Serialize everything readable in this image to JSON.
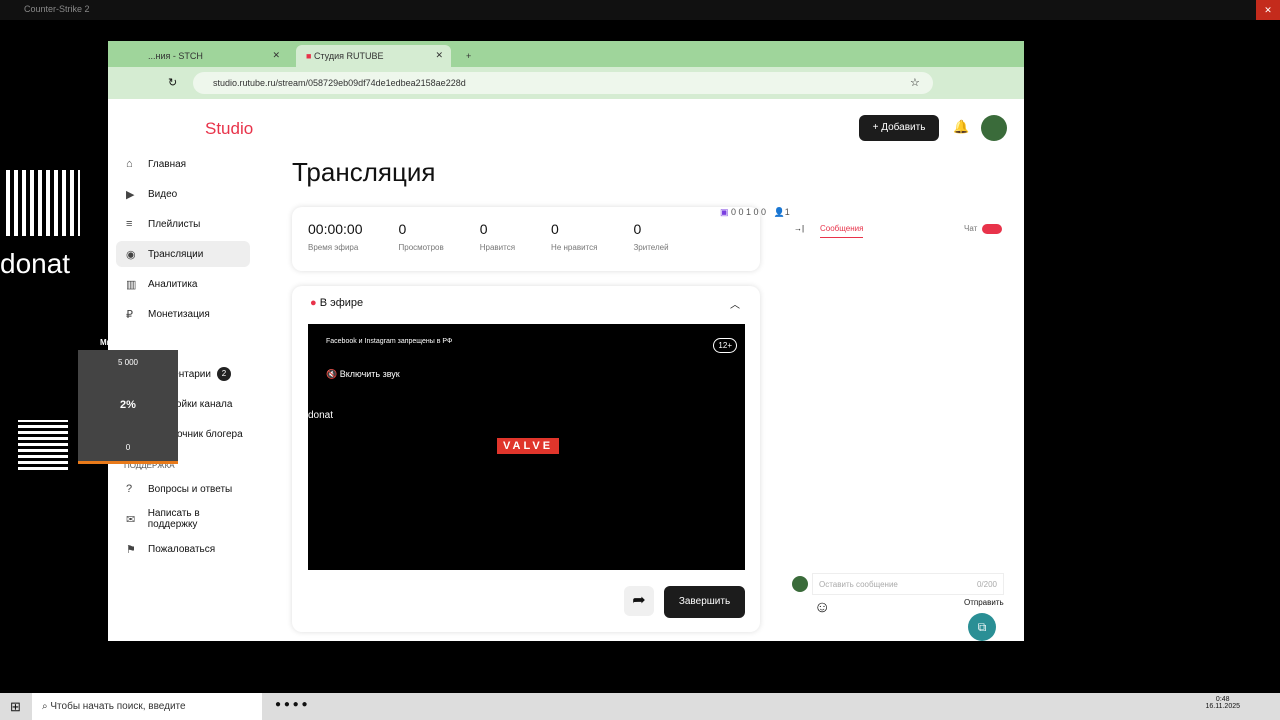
{
  "os": {
    "window_title": "Counter-Strike 2",
    "taskbar_search": "Чтобы начать поиск, введите",
    "time": "0:48",
    "date": "16.11.2025"
  },
  "browser": {
    "tabs": [
      {
        "label": "...ния - STCH"
      },
      {
        "label": "Студия RUTUBE"
      }
    ],
    "url": "studio.rutube.ru/stream/058729eb09df74de1edbea2158ae228d"
  },
  "header": {
    "logo": "Studio",
    "add_label": "Добавить"
  },
  "sidebar": {
    "items": [
      {
        "label": "Главная",
        "icon": "⌂"
      },
      {
        "label": "Видео",
        "icon": "▶"
      },
      {
        "label": "Плейлисты",
        "icon": "≡"
      },
      {
        "label": "Трансляции",
        "icon": "◉"
      },
      {
        "label": "Аналитика",
        "icon": "▥"
      },
      {
        "label": "Монетизация",
        "icon": "₽"
      },
      {
        "label": "Комментарии",
        "icon": "✉",
        "badge": "2"
      },
      {
        "label": "Настройки канала",
        "icon": "⚙"
      },
      {
        "label": "Справочник блогера",
        "icon": "ⓘ"
      }
    ],
    "support_title": "ПОДДЕРЖКА",
    "support": [
      {
        "label": "Вопросы и ответы",
        "icon": "?"
      },
      {
        "label": "Написать в поддержку",
        "icon": "✉"
      },
      {
        "label": "Пожаловаться",
        "icon": "⚑"
      }
    ]
  },
  "main": {
    "title": "Трансляция",
    "stats": [
      {
        "value": "00:00:00",
        "label": "Время эфира"
      },
      {
        "value": "0",
        "label": "Просмотров"
      },
      {
        "value": "0",
        "label": "Нравится"
      },
      {
        "value": "0",
        "label": "Не нравится"
      },
      {
        "value": "0",
        "label": "Зрителей"
      }
    ],
    "live_label": "В эфире",
    "video_notice": "Facebook и Instagram запрещены в РФ",
    "age": "12+",
    "unmute": "Включить звук",
    "video_logo": "VALVE",
    "video_donat": "donat",
    "finish_label": "Завершить"
  },
  "chat": {
    "platforms": "0  0  1  0  0",
    "viewers": "1",
    "tab": "Сообщения",
    "toggle_label": "Чат",
    "placeholder": "Оставить сообщение",
    "counter": "0/200",
    "send": "Отправить"
  },
  "overlay": {
    "donat": "donat",
    "mic_label": "Микрофон",
    "max": "5 000",
    "percent": "2%",
    "min": "0",
    "progress": 0.02
  }
}
